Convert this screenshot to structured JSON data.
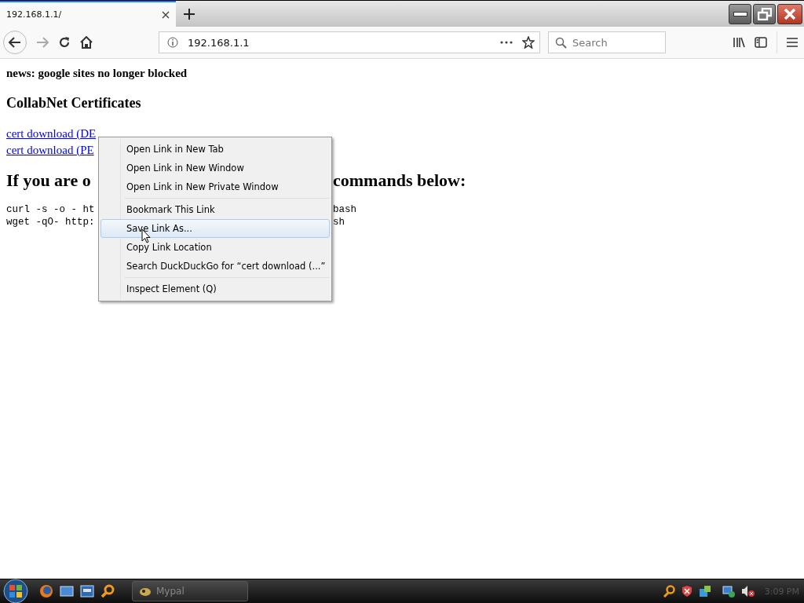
{
  "tabs": [
    {
      "title": "192.168.1.1/",
      "selected": true
    }
  ],
  "toolbar": {
    "url": "192.168.1.1",
    "search_placeholder": "Search"
  },
  "page": {
    "news": "news: google sites no longer blocked",
    "heading": "CollabNet Certificates",
    "links": [
      "cert download (DE",
      "cert download (PE"
    ],
    "instruction": {
      "left": "If you are o",
      "right": "commands below:"
    },
    "commands": [
      {
        "left": "curl -s -o - ht",
        "right": "bash"
      },
      {
        "left": "wget -qO- http:",
        "right": "sh"
      }
    ]
  },
  "context_menu": {
    "groups": [
      [
        {
          "label": "Open Link in New Tab",
          "selected": false
        },
        {
          "label": "Open Link in New Window",
          "selected": false
        },
        {
          "label": "Open Link in New Private Window",
          "selected": false
        }
      ],
      [
        {
          "label": "Bookmark This Link",
          "selected": false
        },
        {
          "label": "Save Link As...",
          "selected": true
        },
        {
          "label": "Copy Link Location",
          "selected": false
        },
        {
          "label": "Search DuckDuckGo for “cert download (...”",
          "selected": false
        }
      ],
      [
        {
          "label": "Inspect Element (Q)",
          "selected": false
        }
      ]
    ]
  },
  "taskbar": {
    "window_button": "Mypal",
    "clock": "3:09 PM"
  }
}
